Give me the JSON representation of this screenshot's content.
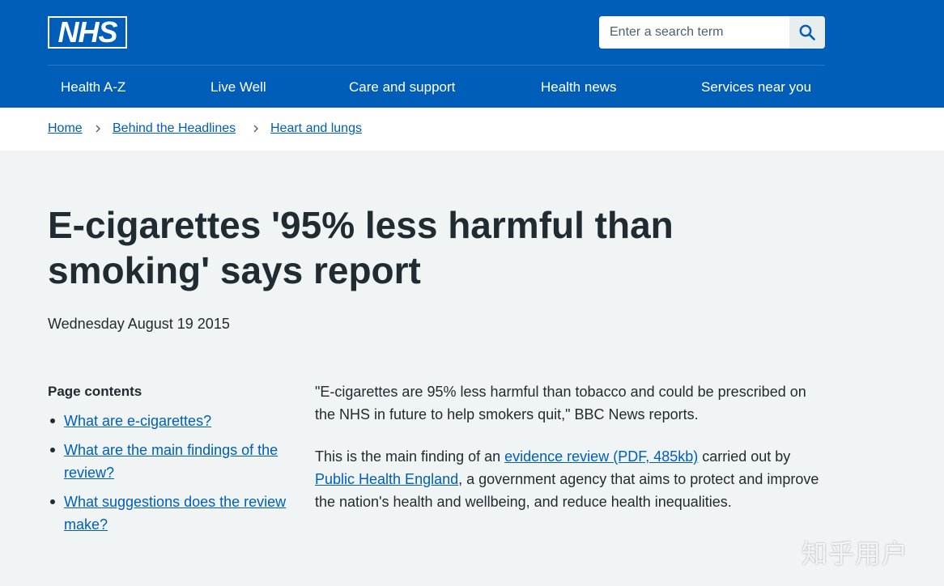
{
  "header": {
    "logo_text": "NHS",
    "search": {
      "placeholder": "Enter a search term"
    },
    "nav": [
      "Health A-Z",
      "Live Well",
      "Care and support",
      "Health news",
      "Services near you"
    ]
  },
  "breadcrumb": [
    "Home",
    "Behind the Headlines",
    "Heart and lungs"
  ],
  "article": {
    "title": "E-cigarettes '95% less harmful than smoking' says report",
    "date": "Wednesday August 19 2015"
  },
  "contents": {
    "heading": "Page contents",
    "items": [
      "What are e-cigarettes?",
      "What are the main findings of the review?",
      "What suggestions does the review make?"
    ]
  },
  "body": {
    "p1": "\"E-cigarettes are 95% less harmful than tobacco and could be prescribed on the NHS in future to help smokers quit,\" BBC News reports.",
    "p2_a": "This is the main finding of an ",
    "p2_link1": "evidence review (PDF, 485kb)",
    "p2_b": " carried out by ",
    "p2_link2": "Public Health England",
    "p2_c": ", a government agency that aims to protect and improve the nation's health and wellbeing, and reduce health inequalities."
  },
  "watermark": "知乎用户",
  "colors": {
    "brand": "#005eb8",
    "text": "#212b32",
    "page_bg": "#f0f4f5"
  }
}
